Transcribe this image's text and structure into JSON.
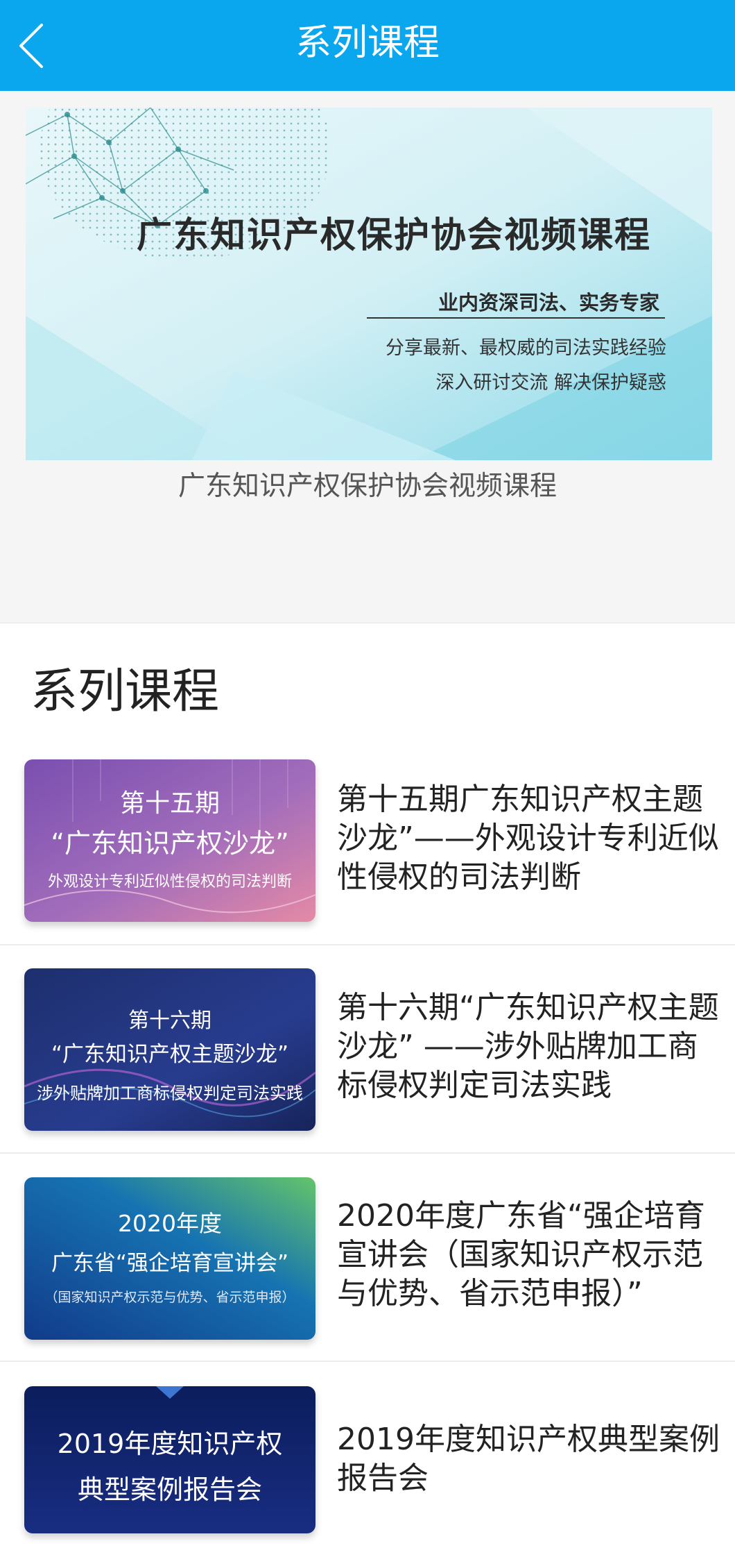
{
  "header": {
    "title": "系列课程",
    "back_icon": "chevron-left-icon"
  },
  "banner": {
    "title": "广东知识产权保护协会视频课程",
    "line1": "业内资深司法、实务专家",
    "line2": "分享最新、最权威的司法实践经验",
    "line3": "深入研讨交流 解决保护疑惑",
    "caption": "广东知识产权保护协会视频课程"
  },
  "section": {
    "title": "系列课程"
  },
  "courses": [
    {
      "thumb_line1": "第十五期",
      "thumb_line2": "“广东知识产权沙龙”",
      "thumb_line3": "外观设计专利近似性侵权的司法判断",
      "title": "第十五期广东知识产权主题沙龙”——外观设计专利近似性侵权的司法判断"
    },
    {
      "thumb_line1": "第十六期",
      "thumb_line2": "“广东知识产权主题沙龙”",
      "thumb_line3": "涉外贴牌加工商标侵权判定司法实践",
      "title": "第十六期“广东知识产权主题沙龙” ——涉外贴牌加工商标侵权判定司法实践"
    },
    {
      "thumb_line1": "2020年度",
      "thumb_line2": "广东省“强企培育宣讲会”",
      "thumb_line3": "（国家知识产权示范与优势、省示范申报）",
      "title": "2020年度广东省“强企培育宣讲会（国家知识产权示范与优势、省示范申报）”"
    },
    {
      "thumb_line1": "2019年度知识产权",
      "thumb_line2": "典型案例报告会",
      "title": "2019年度知识产权典型案例报告会"
    }
  ]
}
